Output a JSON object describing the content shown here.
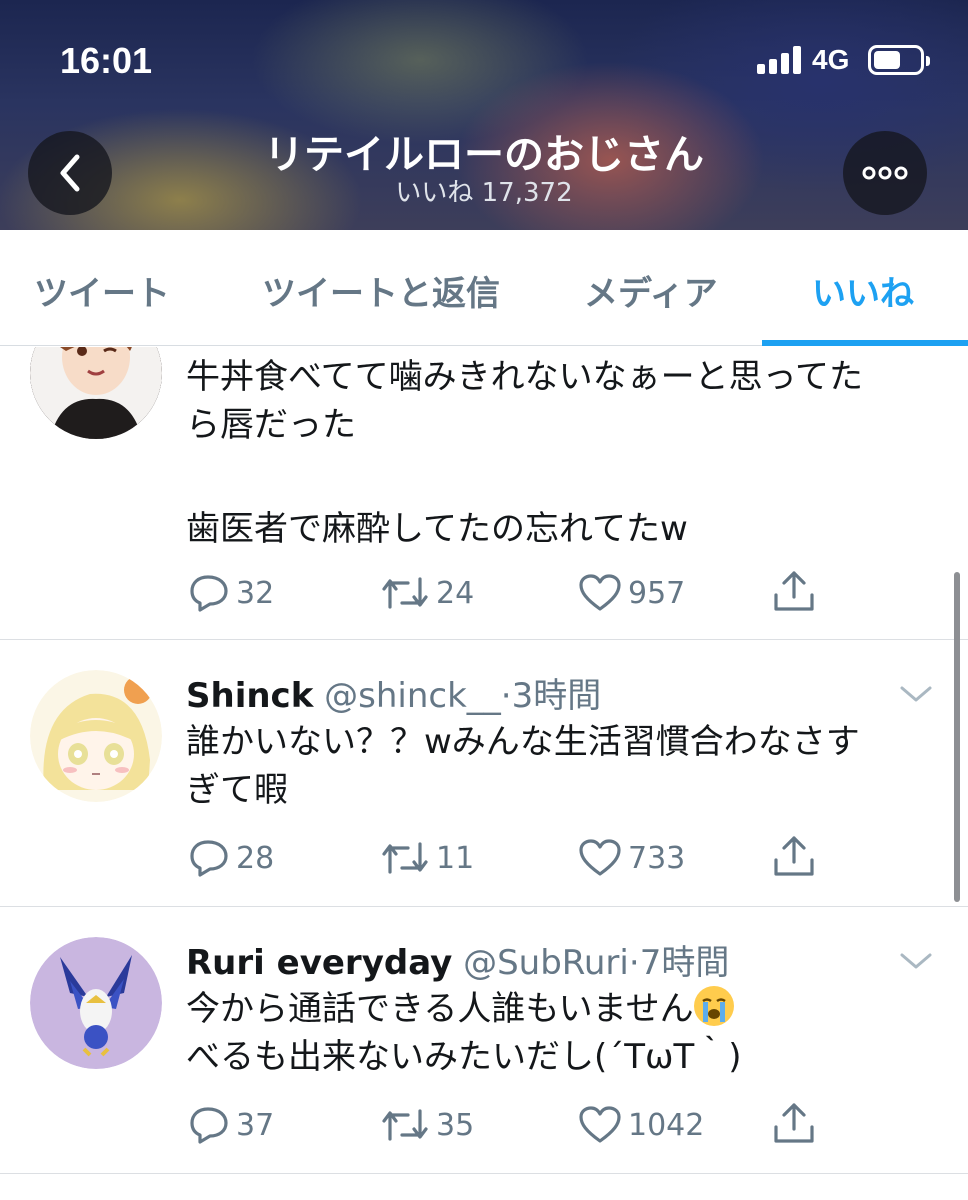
{
  "status_bar": {
    "time": "16:01",
    "network": "4G"
  },
  "header": {
    "title": "リテイルローのおじさん",
    "subtitle": "いいね 17,372"
  },
  "tabs": [
    {
      "label": "ツイート",
      "active": false
    },
    {
      "label": "ツイートと返信",
      "active": false
    },
    {
      "label": "メディア",
      "active": false
    },
    {
      "label": "いいね",
      "active": true
    }
  ],
  "colors": {
    "accent": "#1da1f2",
    "muted": "#657786"
  },
  "tweets": [
    {
      "text_lines": [
        "牛丼食べてて噛みきれないなぁーと思ってた",
        "ら唇だった",
        "",
        "歯医者で麻酔してたの忘れてたw"
      ],
      "replies": "32",
      "retweets": "24",
      "likes": "957"
    },
    {
      "name": "Shinck",
      "handle": "@shinck__",
      "separator": "·",
      "time": "3時間",
      "text_lines": [
        "誰かいない？？wみんな生活習慣合わなさす",
        "ぎて暇"
      ],
      "replies": "28",
      "retweets": "11",
      "likes": "733"
    },
    {
      "name": "Ruri everyday",
      "handle": "@SubRuri",
      "separator": "·",
      "time": "7時間",
      "text_lines": [
        "今から通話できる人誰もいません",
        "べるも出来ないみたいだし(´TωT｀)"
      ],
      "emoji": "loudly-crying-face",
      "replies": "37",
      "retweets": "35",
      "likes": "1042"
    }
  ]
}
